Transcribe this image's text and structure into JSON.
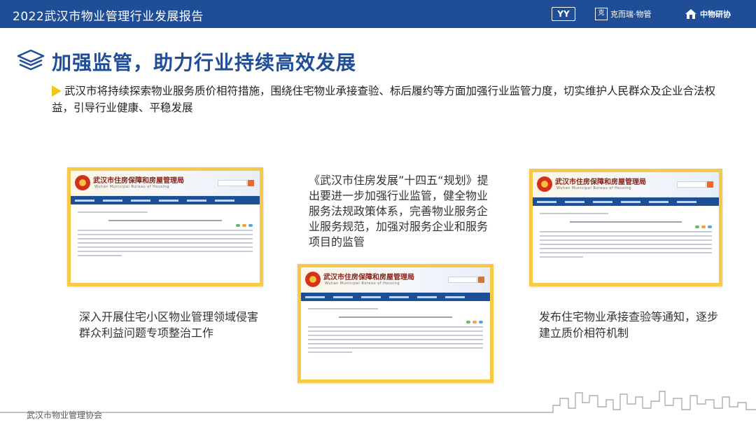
{
  "header": {
    "title": "2022武汉市物业管理行业发展报告",
    "logo_yy": "YY",
    "logo_kr": "克而瑞·物管",
    "logo_zw": "中物研协"
  },
  "slide": {
    "title": "加强监管，助力行业持续高效发展",
    "intro": "武汉市将持续探索物业服务质价相符措施，围绕住宅物业承接查验、标后履约等方面加强行业监管力度，切实维护人民群众及企业合法权益，引导行业健康、平稳发展"
  },
  "documents": [
    {
      "org": "武汉市住房保障和房屋管理局",
      "org_en": "Wuhan Municipal Bureau of Housing"
    },
    {
      "org": "武汉市住房保障和房屋管理局",
      "org_en": "Wuhan Municipal Bureau of Housing"
    },
    {
      "org": "武汉市住房保障和房屋管理局",
      "org_en": "Wuhan Municipal Bureau of Housing"
    }
  ],
  "captions": {
    "left": "深入开展住宅小区物业管理领域侵害群众利益问题专项整治工作",
    "center": "《武汉市住房发展”十四五“规划》提出要进一步加强行业监管，健全物业服务法规政策体系，完善物业服务企业服务规范，加强对服务企业和服务项目的监管",
    "right": "发布住宅物业承接查验等通知，逐步建立质价相符机制"
  },
  "footer": {
    "org": "武汉市物业管理协会"
  },
  "colors": {
    "brand_blue": "#1f4e96",
    "card_border": "#f7c948",
    "accent_triangle": "#f5c518"
  }
}
